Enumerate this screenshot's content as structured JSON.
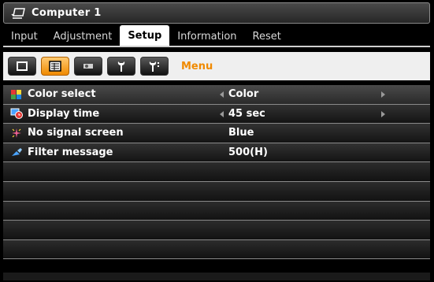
{
  "window": {
    "title": "Computer 1",
    "icon": "monitor-icon"
  },
  "tabs": [
    {
      "label": "Input",
      "active": false
    },
    {
      "label": "Adjustment",
      "active": false
    },
    {
      "label": "Setup",
      "active": true
    },
    {
      "label": "Information",
      "active": false
    },
    {
      "label": "Reset",
      "active": false
    }
  ],
  "toolbar": {
    "icons": [
      "blank-screen-icon",
      "menu-grid-icon",
      "projector-icon",
      "wrench-icon",
      "wrench-two-icon"
    ],
    "selected_index": 1,
    "section_label": "Menu"
  },
  "settings": [
    {
      "label": "Color select",
      "value": "Color",
      "icon": "color-squares-icon",
      "arrows": true
    },
    {
      "label": "Display time",
      "value": "45 sec",
      "icon": "clock-icon",
      "arrows": true
    },
    {
      "label": "No signal screen",
      "value": "Blue",
      "icon": "sparkle-icon",
      "arrows": false
    },
    {
      "label": "Filter message",
      "value": "500(H)",
      "icon": "filter-pen-icon",
      "arrows": false
    }
  ],
  "colors": {
    "accent": "#f08a00",
    "active_tab_bg": "#ffffff",
    "background": "#000000"
  }
}
